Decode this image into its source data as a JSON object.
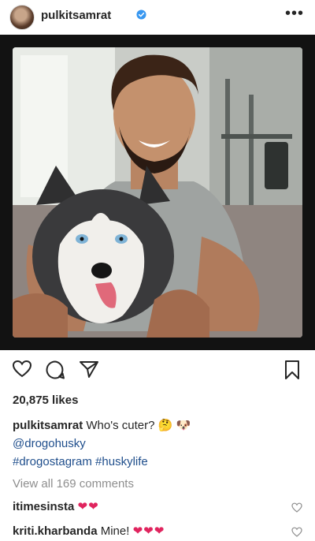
{
  "header": {
    "username": "pulkitsamrat",
    "more_label": "•••"
  },
  "post": {
    "likes": "20,875 likes",
    "caption_user": "pulkitsamrat",
    "caption_text": "Who's cuter? 🤔 🐶",
    "mention": "@drogohusky",
    "hashtags": "#drogostagram #huskylife",
    "view_all": "View all 169 comments"
  },
  "comments": [
    {
      "user": "itimesinsta",
      "text": "",
      "emoji": "❤❤"
    },
    {
      "user": "kriti.kharbanda",
      "text": "Mine!",
      "emoji": "❤❤❤"
    }
  ],
  "colors": {
    "verified": "#3897f0",
    "link": "#1f4e8c",
    "heart": "#e0245e"
  }
}
